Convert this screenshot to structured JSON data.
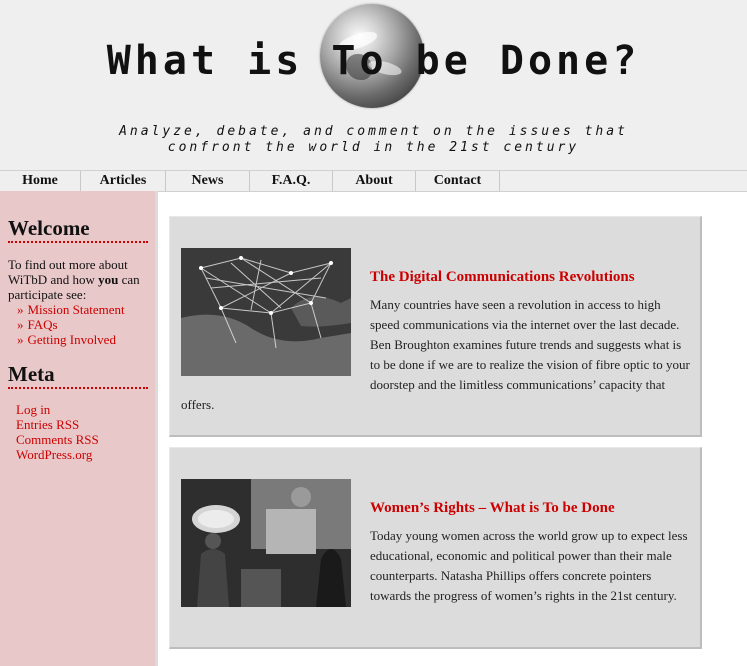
{
  "header": {
    "title": "What is To be Done?",
    "tagline_line1": "Analyze, debate, and comment on the issues that",
    "tagline_line2": "confront the world in the 21st century"
  },
  "nav": {
    "items": [
      "Home",
      "Articles",
      "News",
      "F.A.Q.",
      "About",
      "Contact"
    ]
  },
  "sidebar": {
    "welcome": {
      "heading": "Welcome",
      "text_before": "To find out more about WiTbD and how ",
      "text_bold": "you",
      "text_after": " can participate see:",
      "links": [
        "Mission Statement",
        "FAQs",
        "Getting Involved"
      ]
    },
    "meta": {
      "heading": "Meta",
      "links": [
        "Log in",
        "Entries RSS",
        "Comments RSS",
        "WordPress.org"
      ]
    }
  },
  "posts": [
    {
      "title": "The Digital Communications Revolutions",
      "excerpt": "Many countries have seen a revolution in access to high speed communications via the internet over the last decade. Ben Broughton examines future trends and suggests what is to be done if we are to realize the vision of fibre optic to your doorstep and the limitless communications’ capacity that offers."
    },
    {
      "title": "Women’s Rights – What is To be Done",
      "excerpt": "Today young women across the world grow up to expect less educational, economic and political power than their male counterparts. Natasha Phillips offers concrete pointers towards the progress of women’s rights in the 21st century."
    }
  ],
  "colors": {
    "accent": "#cc0000",
    "sidebar_bg": "#e8c8c9",
    "header_bg": "#efefef",
    "post_bg": "#dcdcdc"
  }
}
